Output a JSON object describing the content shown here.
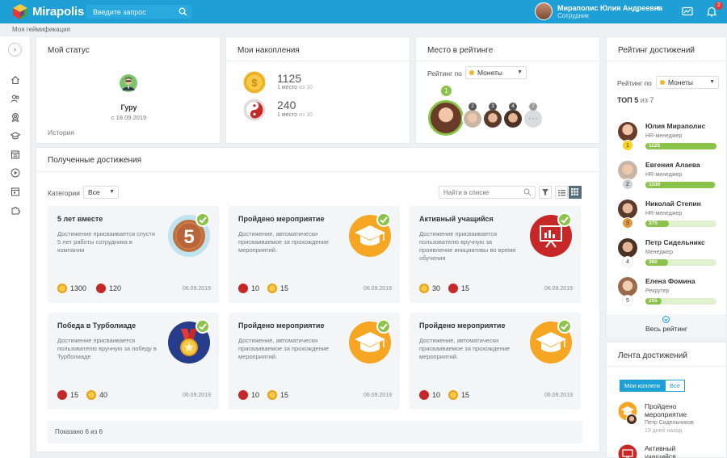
{
  "app": {
    "name": "Mirapolis"
  },
  "search": {
    "placeholder": "Введите запрос"
  },
  "user": {
    "name": "Мираполис Юлия Андреевна",
    "role": "Сотрудник",
    "notifications": "2"
  },
  "breadcrumb": "Моя геймификация",
  "status": {
    "title": "Мой статус",
    "name": "Гуру",
    "date": "с 18.09.2019",
    "history": "История"
  },
  "savings": {
    "title": "Мои накопления",
    "items": [
      {
        "icon": "coin-icon",
        "value": "1125",
        "place": "1 место",
        "of": "из 10"
      },
      {
        "icon": "yin-yang-icon",
        "value": "240",
        "place": "1 место",
        "of": "из 10"
      }
    ]
  },
  "rank": {
    "title": "Место в рейтинге",
    "label": "Рейтинг по",
    "select": "Монеты",
    "leader": "1",
    "others": [
      "2",
      "3",
      "4",
      "7"
    ]
  },
  "achievements": {
    "title": "Полученные достижения",
    "categories_label": "Категории",
    "categories_value": "Все",
    "search_placeholder": "Найти в списке",
    "shown": "Показано 6 из 6",
    "items": [
      {
        "title": "5 лет вместе",
        "desc": "Достижение присваивается спустя 5 лет работы сотрудника в компании",
        "icon": "five-years-icon",
        "r1": "1300",
        "r2": "120",
        "date": "06.09.2019"
      },
      {
        "title": "Пройдено мероприятие",
        "desc": "Достижение, автоматически присваиваемое за прохождение мероприятий.",
        "icon": "graduation-cap-icon",
        "r1": "10",
        "r2": "15",
        "date": "06.09.2019"
      },
      {
        "title": "Активный учащийся",
        "desc": "Достижение присваивается пользователю вручную за проявление инициативы во время обучения",
        "icon": "presentation-icon",
        "r1": "30",
        "r2": "15",
        "date": "06.09.2019"
      },
      {
        "title": "Победа в Турболиаде",
        "desc": "Достижение присваивается пользователю вручную за победу в Турболиаде",
        "icon": "medal-icon",
        "r1": "15",
        "r2": "40",
        "date": "06.09.2019"
      },
      {
        "title": "Пройдено мероприятие",
        "desc": "Достижение, автоматически присваиваемое за прохождение мероприятий.",
        "icon": "graduation-cap-icon",
        "r1": "10",
        "r2": "15",
        "date": "06.09.2019"
      },
      {
        "title": "Пройдено мероприятие",
        "desc": "Достижение, автоматически присваиваемое за прохождение мероприятий.",
        "icon": "graduation-cap-icon",
        "r1": "10",
        "r2": "15",
        "date": "06.09.2019"
      }
    ]
  },
  "leaderboard": {
    "title": "Рейтинг достижений",
    "label": "Рейтинг по",
    "select": "Монеты",
    "top_prefix": "ТОП 5",
    "top_suffix": "из 7",
    "all_link": "Весь рейтинг",
    "rows": [
      {
        "place": "1",
        "name": "Юлия Мираполис",
        "role": "HR-менеджер",
        "value": "1125",
        "fraction": 1.0
      },
      {
        "place": "2",
        "name": "Евгения Алаева",
        "role": "HR-менеджер",
        "value": "1100",
        "fraction": 0.98
      },
      {
        "place": "3",
        "name": "Николай Степин",
        "role": "HR-менеджер",
        "value": "375",
        "fraction": 0.33
      },
      {
        "place": "4",
        "name": "Петр Сидельникс",
        "role": "Менеджер",
        "value": "360",
        "fraction": 0.32
      },
      {
        "place": "5",
        "name": "Елена Фомина",
        "role": "Рекрутер",
        "value": "255",
        "fraction": 0.23
      }
    ]
  },
  "feed": {
    "title": "Лента достижений",
    "tab_colleagues": "Мои коллеги",
    "tab_all": "Все",
    "items": [
      {
        "title": "Пройдено мероприятие",
        "who": "Петр Сидельников",
        "when": "19 дней назад"
      },
      {
        "title": "Активный учащийся",
        "who": "",
        "when": ""
      }
    ]
  },
  "colors": {
    "brand": "#1e9fd6",
    "green": "#8bc34a",
    "coin": "#f2b62a",
    "yinyang": "#c62828"
  }
}
